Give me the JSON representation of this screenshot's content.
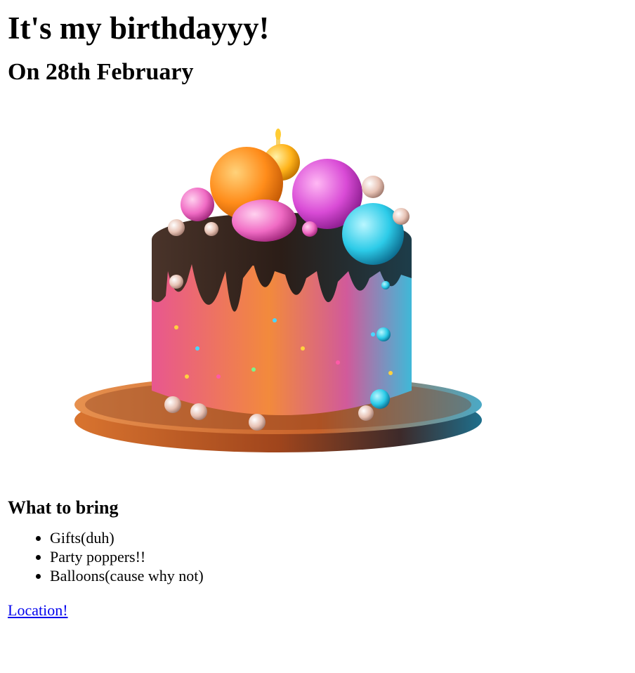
{
  "header": {
    "title": "It's my birthdayyy!",
    "date_line": "On 28th February"
  },
  "image": {
    "subject": "birthday-cake",
    "colors": {
      "plate": "#c8622a",
      "chocolate": "#2b1d17",
      "cake_pink": "#e8578f",
      "cake_orange": "#f28a3c",
      "cake_blue": "#3fb9d8",
      "balloon_orange": "#ff8c1a",
      "balloon_magenta": "#d94bd6",
      "balloon_cyan": "#2ccbe8",
      "balloon_pink": "#f06bc4"
    }
  },
  "bring_section": {
    "heading": "What to bring",
    "items": [
      "Gifts(duh)",
      "Party poppers!!",
      "Balloons(cause why not)"
    ]
  },
  "location_link": {
    "label": "Location!"
  }
}
